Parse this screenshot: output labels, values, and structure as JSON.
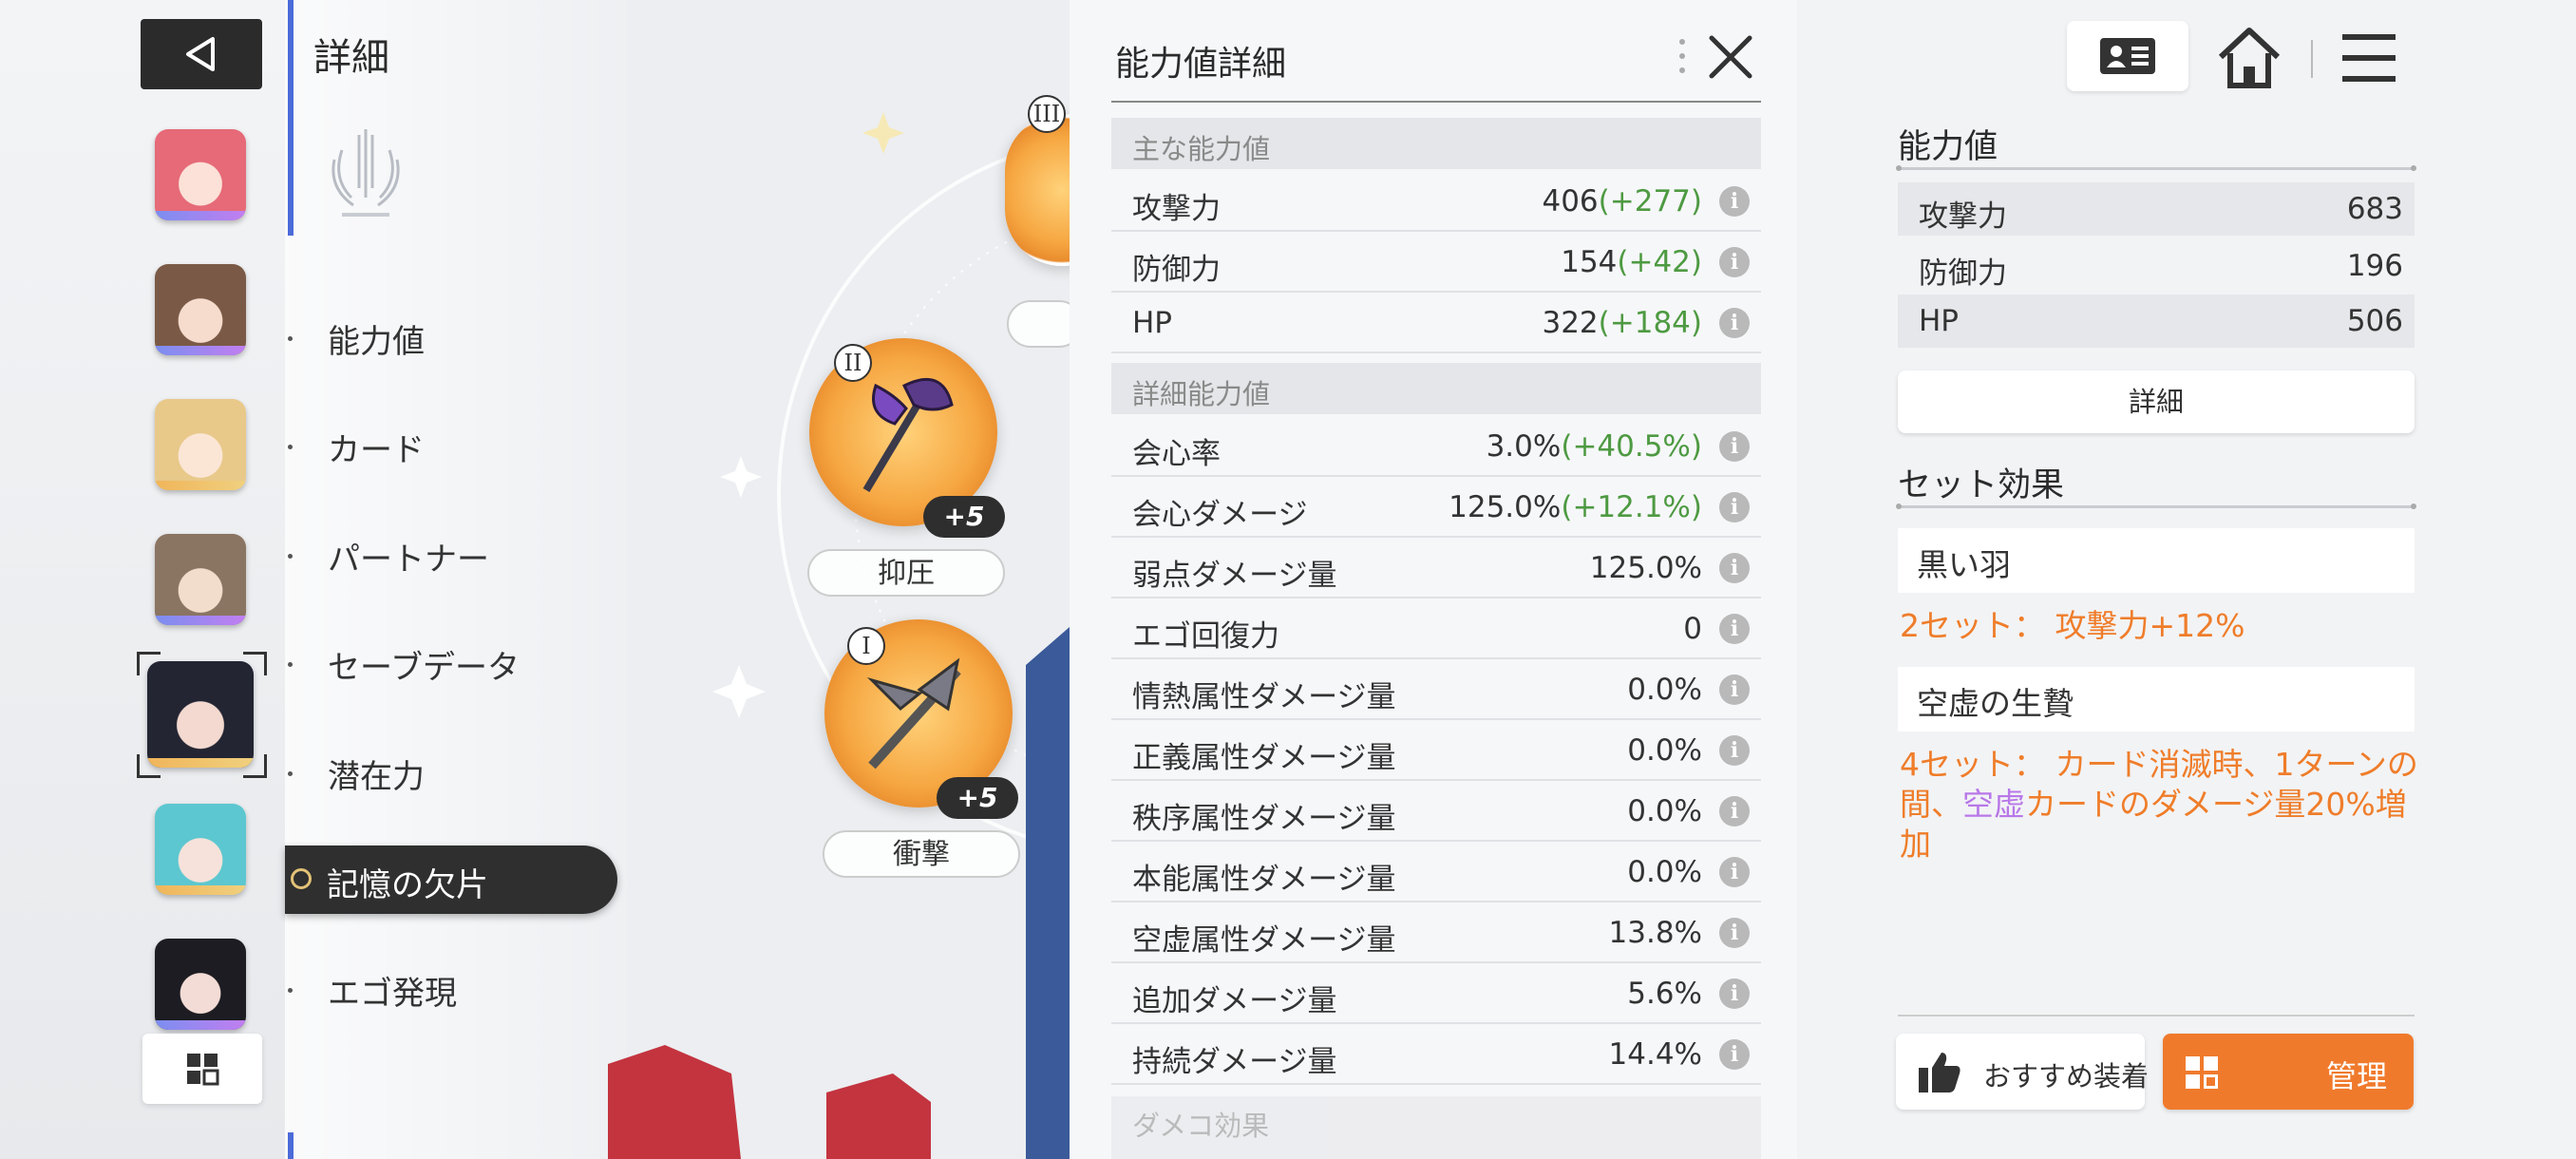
{
  "menu": {
    "title": "詳細",
    "items": [
      "能力値",
      "カード",
      "パートナー",
      "セーブデータ",
      "潜在力",
      "記憶の欠片",
      "エゴ発現"
    ],
    "active_index": 5
  },
  "memory_slots": [
    {
      "roman": "III"
    },
    {
      "roman": "II",
      "level": "+5",
      "label": "抑圧"
    },
    {
      "roman": "I",
      "level": "+5",
      "label": "衝撃"
    }
  ],
  "detail_panel": {
    "title": "能力値詳細",
    "sections": [
      {
        "header": "主な能力値",
        "rows": [
          {
            "name": "攻撃力",
            "base": "406",
            "bonus": "(+277)"
          },
          {
            "name": "防御力",
            "base": "154",
            "bonus": "(+42)"
          },
          {
            "name": "HP",
            "base": "322",
            "bonus": "(+184)"
          }
        ]
      },
      {
        "header": "詳細能力値",
        "rows": [
          {
            "name": "会心率",
            "base": "3.0%",
            "bonus": "(+40.5%)"
          },
          {
            "name": "会心ダメージ",
            "base": "125.0%",
            "bonus": "(+12.1%)"
          },
          {
            "name": "弱点ダメージ量",
            "base": "125.0%",
            "bonus": ""
          },
          {
            "name": "エゴ回復力",
            "base": "0",
            "bonus": ""
          },
          {
            "name": "情熱属性ダメージ量",
            "base": "0.0%",
            "bonus": ""
          },
          {
            "name": "正義属性ダメージ量",
            "base": "0.0%",
            "bonus": ""
          },
          {
            "name": "秩序属性ダメージ量",
            "base": "0.0%",
            "bonus": ""
          },
          {
            "name": "本能属性ダメージ量",
            "base": "0.0%",
            "bonus": ""
          },
          {
            "name": "空虚属性ダメージ量",
            "base": "13.8%",
            "bonus": ""
          },
          {
            "name": "追加ダメージ量",
            "base": "5.6%",
            "bonus": ""
          },
          {
            "name": "持続ダメージ量",
            "base": "14.4%",
            "bonus": ""
          }
        ]
      }
    ],
    "partial_header": "ダメコ効果"
  },
  "right_panel": {
    "stats_heading": "能力値",
    "stats": [
      {
        "name": "攻撃力",
        "value": "683"
      },
      {
        "name": "防御力",
        "value": "196"
      },
      {
        "name": "HP",
        "value": "506"
      }
    ],
    "detail_button": "詳細",
    "set_heading": "セット効果",
    "sets": [
      {
        "name": "黒い羽",
        "effect_prefix": "2セット： 攻撃力+12%"
      },
      {
        "name": "空虚の生贄",
        "effect_prefix": "4セット： カード消滅時、1ターンの間、",
        "effect_highlight": "空虚",
        "effect_suffix": "カードのダメージ量20%増加"
      }
    ],
    "recommend_button": "おすすめ装着",
    "manage_button": "管理"
  },
  "colors": {
    "accent_orange": "#f07a2c",
    "bonus_green": "#4e9a42",
    "void_purple": "#b878e8",
    "menu_active_bg": "#2f2f2f"
  }
}
